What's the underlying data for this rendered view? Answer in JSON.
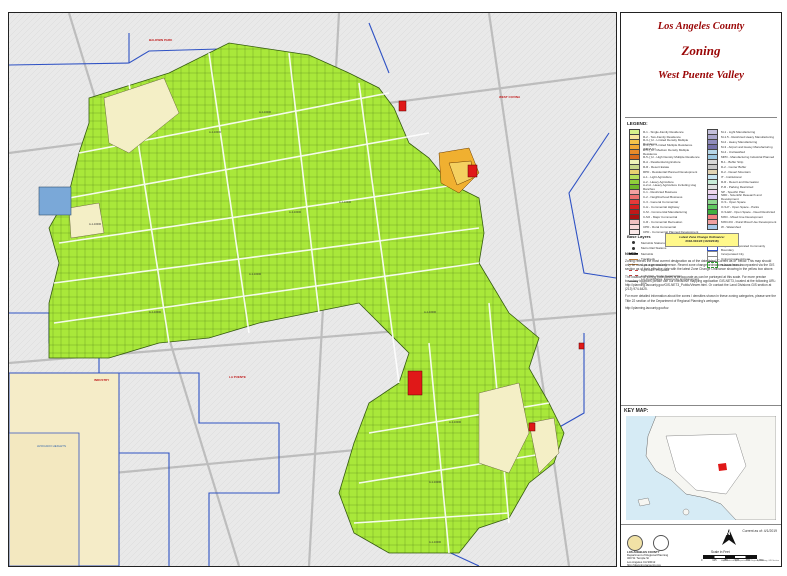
{
  "title": {
    "line1": "Los Angeles County",
    "line2": "Zoning",
    "line3": "West Puente Valley"
  },
  "legend": {
    "heading": "LEGEND:",
    "zones_left": [
      {
        "label": "R-1 - Single-Family Residence",
        "color": "#d6f08a"
      },
      {
        "label": "R-2 - Two-Family Residence",
        "color": "#f7e49a"
      },
      {
        "label": "R-3-( )U - Limited Density Multiple Residence",
        "color": "#f3c24a"
      },
      {
        "label": "R-4-( )U - Limited Multiple Residence (SB4/UC)",
        "color": "#f0a834"
      },
      {
        "label": "R-5-( )U - Medium Density Multiple Residence",
        "color": "#e88a2a"
      },
      {
        "label": "R-5-( )U - High Density Multiple Residence",
        "color": "#d86a1c"
      },
      {
        "label": "R-A - Residential Agriculture",
        "color": "#eef4b8"
      },
      {
        "label": "R-R - Resort Estate",
        "color": "#c8d88a"
      },
      {
        "label": "RPD - Residential Planned Development",
        "color": "#e8d070"
      },
      {
        "label": "A-1 - Light Agriculture",
        "color": "#b6e05a"
      },
      {
        "label": "A-2 - Heavy Agriculture",
        "color": "#8fcf3a"
      },
      {
        "label": "A-2-H - Heavy Agriculture Including Hog Ranches",
        "color": "#6fb82a"
      },
      {
        "label": "C-1 - Restricted Business",
        "color": "#f4a0a0"
      },
      {
        "label": "C-2 - Neighborhood Business",
        "color": "#ee7070"
      },
      {
        "label": "C-3 - General Commercial",
        "color": "#e53a3a"
      },
      {
        "label": "C-H - Commercial Highway",
        "color": "#d42020"
      },
      {
        "label": "C-M - Commercial Manufacturing",
        "color": "#c01818"
      },
      {
        "label": "C-MJ - Major Commercial",
        "color": "#a81010"
      },
      {
        "label": "C-R - Commercial Recreation",
        "color": "#f0c0c0"
      },
      {
        "label": "CPD - Rural Commercial",
        "color": "#f7d8d8"
      },
      {
        "label": "CPD - Commercial Planned Development",
        "color": "#fae8e8"
      }
    ],
    "zones_right": [
      {
        "label": "M-1 - Light Manufacturing",
        "color": "#c4c0dc"
      },
      {
        "label": "M-1.5 - Restricted Heavy Manufacturing",
        "color": "#aaa6cc"
      },
      {
        "label": "M-2 - Heavy Manufacturing",
        "color": "#908cbc"
      },
      {
        "label": "M-3 - Airport and Heavy Manufacturing",
        "color": "#7672aa"
      },
      {
        "label": "M-4 - Unclassified",
        "color": "#b6d6e8"
      },
      {
        "label": "MPD - Manufacturing Industrial Planned",
        "color": "#9cc6e0"
      },
      {
        "label": "B-1 - Buffer Strip",
        "color": "#d8d8d8"
      },
      {
        "label": "D-2 - Center Buffer",
        "color": "#c8c8c8"
      },
      {
        "label": "D-2 - Desert Mountain",
        "color": "#e2d4b4"
      },
      {
        "label": "IT - Institutional",
        "color": "#c8e4f0"
      },
      {
        "label": "R-R - Resort and Recreation",
        "color": "#c8ecd8"
      },
      {
        "label": "P-R - Parking Restricted",
        "color": "#e0e0e0"
      },
      {
        "label": "SP - Specific Plan",
        "color": "#f0d8f0"
      },
      {
        "label": "SRD - Scientific Research and Development",
        "color": "#d8c8f0"
      },
      {
        "label": "O-S - Open Space",
        "color": "#90d890"
      },
      {
        "label": "O-S-P - Open Space - Parks",
        "color": "#60c860"
      },
      {
        "label": "O-S-ER - Open Space - Deed Restricted",
        "color": "#40b040"
      },
      {
        "label": "MXD - Mixed Use Development",
        "color": "#f08080"
      },
      {
        "label": "MXD-RU - Rural Mixed Use Development",
        "color": "#f0a0a0"
      },
      {
        "label": "W - Watershed",
        "color": "#a8c8e8"
      }
    ],
    "base_layers_heading": "Base Layers",
    "base_layers": [
      {
        "label": "Metrolink Stations",
        "glyph": "dot"
      },
      {
        "label": "Metro Rail Stations",
        "glyph": "dot"
      },
      {
        "label": "Metrolink",
        "glyph": "rail"
      },
      {
        "label": "Trackbeds",
        "glyph": "line"
      },
      {
        "label": "Light Rail - Existing",
        "glyph": "line"
      },
      {
        "label": "Light Rail - Proposed",
        "glyph": "dash"
      },
      {
        "label": "Light Rail - Under Construction",
        "glyph": "dash"
      },
      {
        "label": "Lot Coordinates, Easements and Easement Line",
        "glyph": "thin"
      }
    ],
    "boundaries": [
      {
        "label": "Parcels",
        "glyph": "box"
      },
      {
        "label": "City / Unincorporated Community Boundary",
        "glyph": "bluebox"
      },
      {
        "label": "Incorporated City",
        "glyph": "white"
      },
      {
        "label": "Unincorporated Areas",
        "glyph": "white"
      },
      {
        "label": "National Forest",
        "glyph": "greendash"
      }
    ]
  },
  "zone_change": {
    "heading": "Latest Zone Change Ordinance:",
    "value": "2018-0044/Z (10/4/2018)"
  },
  "notes": {
    "heading": "NOTE:",
    "paragraphs": [
      "Zoning reflects the most current designation as of the date listed \"Current as of\" below. This map should only be used as a general reference. Recent zone change ordinances have been incorporated via the GIS section as of their effective date with the latest Zone Change Ordinance showing in the yellow box above.",
      "The location of zoning boundaries is as accurate as can be portrayed at this scale. For more precise boundary locations please use our interactive mapping application GIS-NET3, located at the following URL: http://planning.lacounty.gov/GIS-NET3_Public/Viewer.html. Or contact the Land Divisions GIS section at (213) 974-6425.",
      "For more detailed information about the zones / densities shown in these zoning categories, please see the Title 22 section of the Department of Regional Planning's webpage.",
      "http://planning.lacounty.gov/luz"
    ]
  },
  "key_map": {
    "heading": "KEY MAP:"
  },
  "footer": {
    "current_as_of": "Current as of: 4/1/2019",
    "agency_line1": "LOS ANGELES COUNTY",
    "agency_line2": "Department of Regional Planning",
    "agency_line3": "320 W. Temple St",
    "agency_line4": "Los Angeles CA 90012",
    "agency_line5": "http://planning.lacounty.gov",
    "north_label": "N",
    "scale_title": "Scale in Feet",
    "scale_ticks": [
      "0",
      "125",
      "250",
      "500",
      "750",
      "1,000"
    ],
    "credit": "Map Produced by: Department of Regional Planning, GIS Section"
  },
  "map_labels": {
    "zone_labels": [
      "A-1-10000",
      "A-1-10000",
      "A-1-10000",
      "A-1-10000",
      "A-1-10000",
      "A-1-10000",
      "A-1-10000",
      "A-1-10000",
      "A-1-10000",
      "A-1-10000",
      "A-1-10000"
    ],
    "places": [
      {
        "name": "BALDWIN PARK",
        "color": "red"
      },
      {
        "name": "WEST COVINA",
        "color": "red"
      },
      {
        "name": "LA PUENTE",
        "color": "red"
      },
      {
        "name": "INDUSTRY",
        "color": "red"
      },
      {
        "name": "AVOCADO HEIGHTS",
        "color": "blue"
      }
    ]
  }
}
